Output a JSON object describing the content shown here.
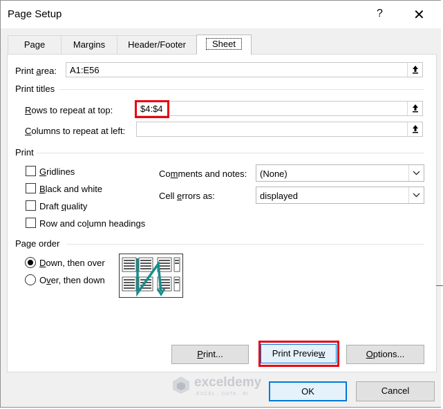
{
  "title": "Page Setup",
  "help_glyph": "?",
  "close_glyph": "✕",
  "tabs": [
    {
      "label": "Page"
    },
    {
      "label": "Margins"
    },
    {
      "label": "Header/Footer"
    },
    {
      "label": "Sheet"
    }
  ],
  "print_area": {
    "label_pre": "Print ",
    "label_u": "a",
    "label_post": "rea:",
    "value": "A1:E56"
  },
  "print_titles": {
    "section": "Print titles",
    "rows": {
      "label_u": "R",
      "label_post": "ows to repeat at top:",
      "value": "$4:$4"
    },
    "cols": {
      "label_u": "C",
      "label_post": "olumns to repeat at left:",
      "value": ""
    }
  },
  "print": {
    "section": "Print",
    "gridlines": {
      "label_u": "G",
      "label_post": "ridlines"
    },
    "bw": {
      "label_u": "B",
      "label_post": "lack and white"
    },
    "draft": {
      "label_pre": "Draft ",
      "label_u": "q",
      "label_post": "uality"
    },
    "headings": {
      "label_pre": "Row and co",
      "label_u": "l",
      "label_post": "umn headings"
    },
    "comments": {
      "label_pre": "Co",
      "label_u": "m",
      "label_post": "ments and notes:",
      "value": "(None)"
    },
    "errors": {
      "label_pre": "Cell ",
      "label_u": "e",
      "label_post": "rrors as:",
      "value": "displayed"
    }
  },
  "page_order": {
    "section": "Page order",
    "down": {
      "label_u": "D",
      "label_post": "own, then over"
    },
    "over": {
      "label_pre": "O",
      "label_u": "v",
      "label_post": "er, then down"
    }
  },
  "buttons": {
    "print": {
      "label_u": "P",
      "label_post": "rint..."
    },
    "preview": {
      "label_pre": "Print Previe",
      "label_u": "w",
      "label_post": ""
    },
    "options": {
      "label_u": "O",
      "label_post": "ptions..."
    },
    "ok": "OK",
    "cancel": "Cancel"
  },
  "watermark": {
    "name": "exceldemy",
    "tagline": "EXCEL · DATA · BI"
  },
  "colors": {
    "highlight": "#e8000d",
    "arrow": "#1a8c8c"
  }
}
